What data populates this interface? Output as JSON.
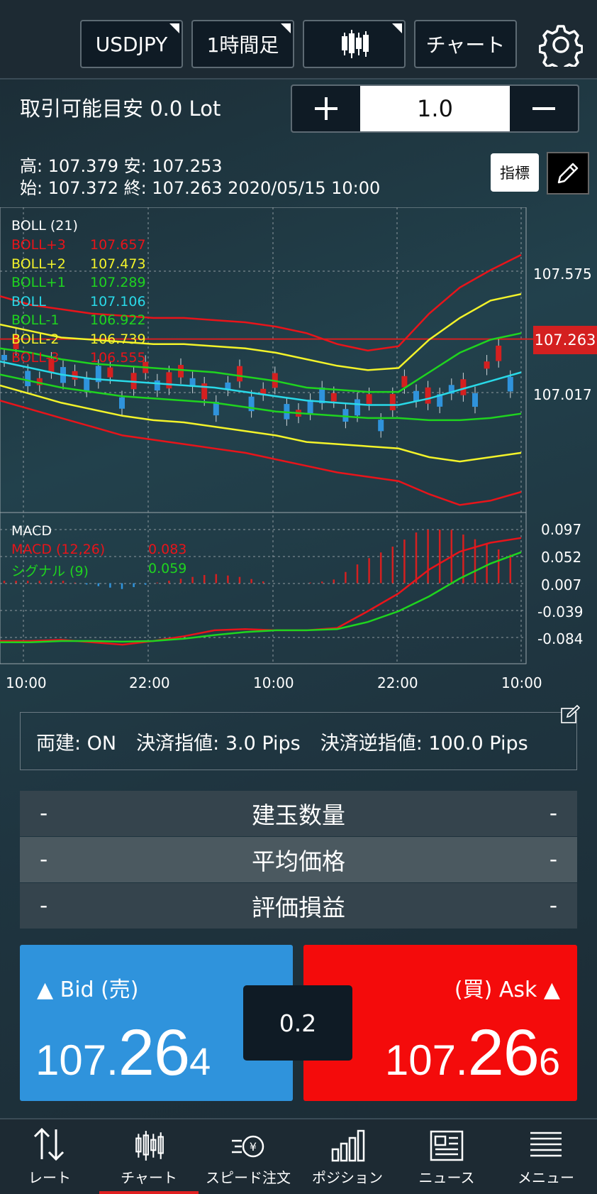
{
  "toolbar": {
    "symbol": "USDJPY",
    "timeframe": "1時間足",
    "chart_type_icon": "candlestick-icon",
    "mode": "チャート",
    "settings_icon": "gear-icon"
  },
  "order": {
    "available_label": "取引可能目安 0.0 Lot",
    "quantity": "1.0",
    "plus": "+",
    "minus": "−"
  },
  "ohlc": {
    "line1": "高: 107.379  安: 107.253",
    "line2": "始: 107.372  終: 107.263  2020/05/15 10:00",
    "indicator_button": "指標",
    "pen_icon": "pencil-icon"
  },
  "boll": {
    "title": "BOLL (21)",
    "rows": [
      {
        "name": "BOLL+3",
        "value": "107.657",
        "color": "#e8141a"
      },
      {
        "name": "BOLL+2",
        "value": "107.473",
        "color": "#f3f32a"
      },
      {
        "name": "BOLL+1",
        "value": "107.289",
        "color": "#1fd41f"
      },
      {
        "name": "BOLL",
        "value": "107.106",
        "color": "#29d9e8"
      },
      {
        "name": "BOLL-1",
        "value": "106.922",
        "color": "#1fd41f"
      },
      {
        "name": "BOLL-2",
        "value": "106.739",
        "color": "#f3f32a"
      },
      {
        "name": "BOLL-3",
        "value": "106.555",
        "color": "#e8141a"
      }
    ]
  },
  "macd": {
    "title": "MACD",
    "rows": [
      {
        "name": "MACD (12,26)",
        "value": "0.083",
        "color": "#e8141a"
      },
      {
        "name": "シグナル (9)",
        "value": "0.059",
        "color": "#1fd41f"
      }
    ]
  },
  "price_axis": {
    "p1": "107.575",
    "p2": "107.017",
    "current": "107.263"
  },
  "macd_axis": {
    "a1": "0.097",
    "a2": "0.052",
    "a3": "0.007",
    "a4": "-0.039",
    "a5": "-0.084"
  },
  "time_axis": [
    "10:00",
    "22:00",
    "10:00",
    "22:00",
    "10:00"
  ],
  "settings": {
    "hedge": "両建: ON",
    "limit": "決済指値: 3.0 Pips",
    "stop": "決済逆指値: 100.0 Pips",
    "edit_icon": "edit-icon"
  },
  "positions": [
    {
      "left": "-",
      "label": "建玉数量",
      "right": "-"
    },
    {
      "left": "-",
      "label": "平均価格",
      "right": "-"
    },
    {
      "left": "-",
      "label": "評価損益",
      "right": "-"
    }
  ],
  "bid": {
    "label": "▲ Bid (売)",
    "p1": "107.",
    "p2": "26",
    "p3": "4",
    "color": "#2f93dc"
  },
  "ask": {
    "label": "(買) Ask ▲",
    "p1": "107.",
    "p2": "26",
    "p3": "6",
    "color": "#f40b0b"
  },
  "spread": "0.2",
  "tabs": [
    {
      "label": "レート",
      "icon": "rate-arrows-icon"
    },
    {
      "label": "チャート",
      "icon": "candlestick-icon"
    },
    {
      "label": "スピード注文",
      "icon": "speed-order-icon"
    },
    {
      "label": "ポジション",
      "icon": "bar-chart-icon"
    },
    {
      "label": "ニュース",
      "icon": "newspaper-icon"
    },
    {
      "label": "メニュー",
      "icon": "menu-icon"
    }
  ],
  "chart_data": [
    {
      "type": "line",
      "title": "BOLL (21)",
      "x_ticks": [
        "10:00",
        "22:00",
        "10:00",
        "22:00",
        "10:00"
      ],
      "y_ticks": [
        107.575,
        107.017
      ],
      "current_price": 107.263,
      "series": [
        {
          "name": "BOLL+3",
          "color": "#e8141a",
          "values": [
            107.46,
            107.42,
            107.4,
            107.38,
            107.37,
            107.36,
            107.36,
            107.35,
            107.34,
            107.32,
            107.29,
            107.24,
            107.21,
            107.23,
            107.38,
            107.5,
            107.58,
            107.65
          ]
        },
        {
          "name": "BOLL+2",
          "color": "#f3f32a",
          "values": [
            107.33,
            107.3,
            107.27,
            107.26,
            107.25,
            107.24,
            107.24,
            107.23,
            107.22,
            107.2,
            107.17,
            107.14,
            107.12,
            107.13,
            107.26,
            107.36,
            107.44,
            107.47
          ]
        },
        {
          "name": "BOLL+1",
          "color": "#1fd41f",
          "values": [
            107.22,
            107.2,
            107.17,
            107.15,
            107.14,
            107.13,
            107.12,
            107.11,
            107.09,
            107.07,
            107.04,
            107.03,
            107.02,
            107.02,
            107.11,
            107.2,
            107.26,
            107.29
          ]
        },
        {
          "name": "BOLL",
          "color": "#29d9e8",
          "values": [
            107.16,
            107.13,
            107.1,
            107.08,
            107.07,
            107.06,
            107.05,
            107.04,
            107.02,
            107.0,
            106.98,
            106.97,
            106.96,
            106.96,
            106.99,
            107.03,
            107.07,
            107.11
          ]
        },
        {
          "name": "BOLL-1",
          "color": "#1fd41f",
          "values": [
            107.1,
            107.07,
            107.04,
            107.02,
            107.0,
            106.99,
            106.98,
            106.97,
            106.95,
            106.93,
            106.92,
            106.91,
            106.9,
            106.9,
            106.89,
            106.89,
            106.9,
            106.92
          ]
        },
        {
          "name": "BOLL-2",
          "color": "#f3f32a",
          "values": [
            107.05,
            107.01,
            106.97,
            106.94,
            106.91,
            106.89,
            106.88,
            106.86,
            106.84,
            106.82,
            106.79,
            106.78,
            106.77,
            106.76,
            106.72,
            106.7,
            106.72,
            106.74
          ]
        },
        {
          "name": "BOLL-3",
          "color": "#e8141a",
          "values": [
            106.98,
            106.94,
            106.9,
            106.86,
            106.82,
            106.8,
            106.78,
            106.76,
            106.74,
            106.71,
            106.68,
            106.65,
            106.63,
            106.61,
            106.55,
            106.5,
            106.52,
            106.56
          ]
        }
      ]
    },
    {
      "type": "line",
      "title": "MACD",
      "y_ticks": [
        0.097,
        0.052,
        0.007,
        -0.039,
        -0.084
      ],
      "series": [
        {
          "name": "MACD (12,26)",
          "color": "#e8141a",
          "values": [
            -0.09,
            -0.09,
            -0.088,
            -0.092,
            -0.096,
            -0.09,
            -0.082,
            -0.072,
            -0.07,
            -0.072,
            -0.072,
            -0.068,
            -0.04,
            -0.01,
            0.03,
            0.06,
            0.075,
            0.083
          ]
        },
        {
          "name": "シグナル (9)",
          "color": "#1fd41f",
          "values": [
            -0.092,
            -0.092,
            -0.09,
            -0.09,
            -0.091,
            -0.09,
            -0.086,
            -0.08,
            -0.075,
            -0.072,
            -0.072,
            -0.07,
            -0.058,
            -0.04,
            -0.015,
            0.015,
            0.04,
            0.059
          ]
        }
      ]
    }
  ]
}
